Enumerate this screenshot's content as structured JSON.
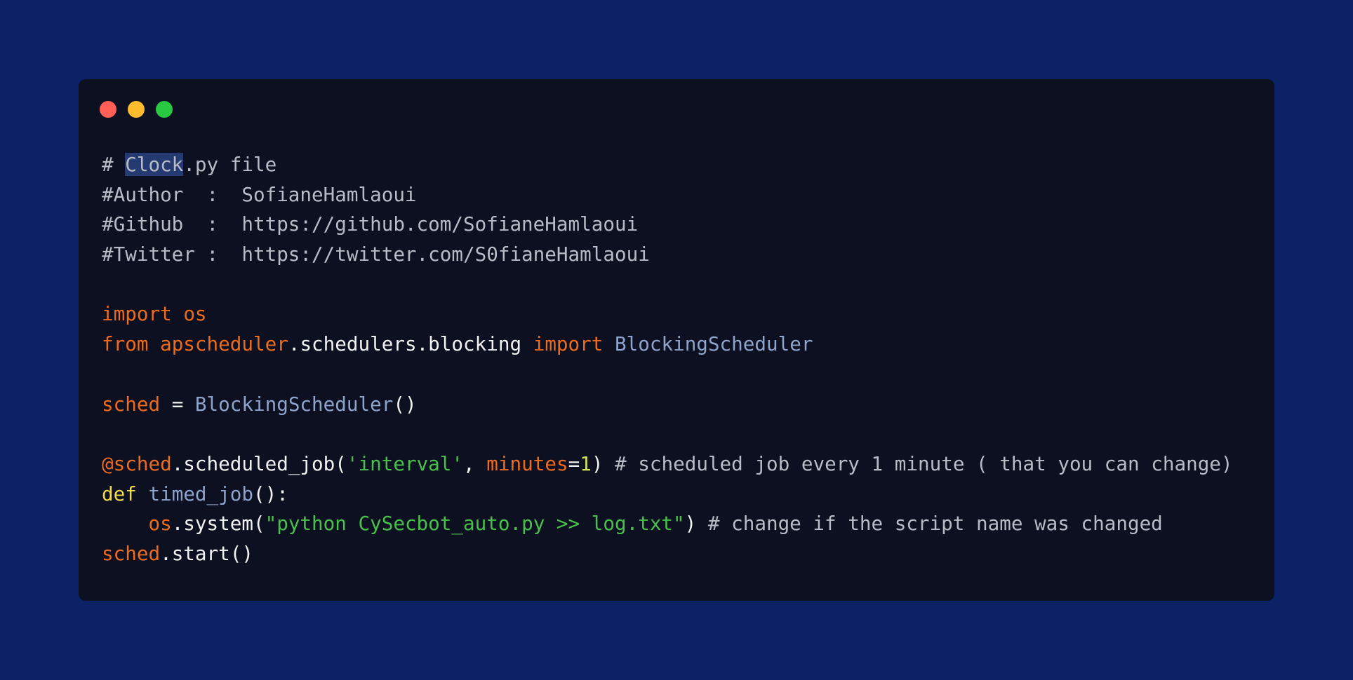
{
  "window": {
    "controls": [
      {
        "name": "close",
        "color": "#ff5f57"
      },
      {
        "name": "minimize",
        "color": "#febc2e"
      },
      {
        "name": "maximize",
        "color": "#28c840"
      }
    ]
  },
  "colors": {
    "background": "#0b2266",
    "editor": "#0d1021",
    "selection": "#263a72"
  },
  "code": {
    "language": "python",
    "lines": [
      [
        {
          "t": "# ",
          "c": "comment"
        },
        {
          "t": "Clock",
          "c": "comment",
          "sel": true
        },
        {
          "t": ".py file",
          "c": "comment"
        }
      ],
      [
        {
          "t": "#Author  :  SofianeHamlaoui",
          "c": "comment"
        }
      ],
      [
        {
          "t": "#Github  :  https://github.com/SofianeHamlaoui",
          "c": "comment"
        }
      ],
      [
        {
          "t": "#Twitter :  https://twitter.com/S0fianeHamlaoui",
          "c": "comment"
        }
      ],
      [],
      [
        {
          "t": "import",
          "c": "kw"
        },
        {
          "t": " ",
          "c": "plain"
        },
        {
          "t": "os",
          "c": "kw"
        }
      ],
      [
        {
          "t": "from",
          "c": "kw"
        },
        {
          "t": " ",
          "c": "plain"
        },
        {
          "t": "apscheduler",
          "c": "kw"
        },
        {
          "t": ".schedulers.blocking ",
          "c": "plain"
        },
        {
          "t": "import",
          "c": "kw"
        },
        {
          "t": " ",
          "c": "plain"
        },
        {
          "t": "BlockingScheduler",
          "c": "cls"
        }
      ],
      [],
      [
        {
          "t": "sched",
          "c": "kw"
        },
        {
          "t": " = ",
          "c": "plain"
        },
        {
          "t": "BlockingScheduler",
          "c": "cls"
        },
        {
          "t": "()",
          "c": "plain"
        }
      ],
      [],
      [
        {
          "t": "@sched",
          "c": "kw"
        },
        {
          "t": ".scheduled_job(",
          "c": "plain"
        },
        {
          "t": "'interval'",
          "c": "str"
        },
        {
          "t": ", ",
          "c": "plain"
        },
        {
          "t": "minutes",
          "c": "kw"
        },
        {
          "t": "=",
          "c": "plain"
        },
        {
          "t": "1",
          "c": "num"
        },
        {
          "t": ") ",
          "c": "plain"
        },
        {
          "t": "# scheduled job every 1 minute ( that you can change)",
          "c": "comment"
        }
      ],
      [
        {
          "t": "def",
          "c": "def"
        },
        {
          "t": " ",
          "c": "plain"
        },
        {
          "t": "timed_job",
          "c": "cls"
        },
        {
          "t": "():",
          "c": "plain"
        }
      ],
      [
        {
          "t": "    ",
          "c": "plain"
        },
        {
          "t": "os",
          "c": "kw"
        },
        {
          "t": ".system(",
          "c": "plain"
        },
        {
          "t": "\"python CySecbot_auto.py >> log.txt\"",
          "c": "str"
        },
        {
          "t": ") ",
          "c": "plain"
        },
        {
          "t": "# change if the script name was changed",
          "c": "comment"
        }
      ],
      [
        {
          "t": "sched",
          "c": "kw"
        },
        {
          "t": ".start()",
          "c": "plain"
        }
      ]
    ]
  }
}
